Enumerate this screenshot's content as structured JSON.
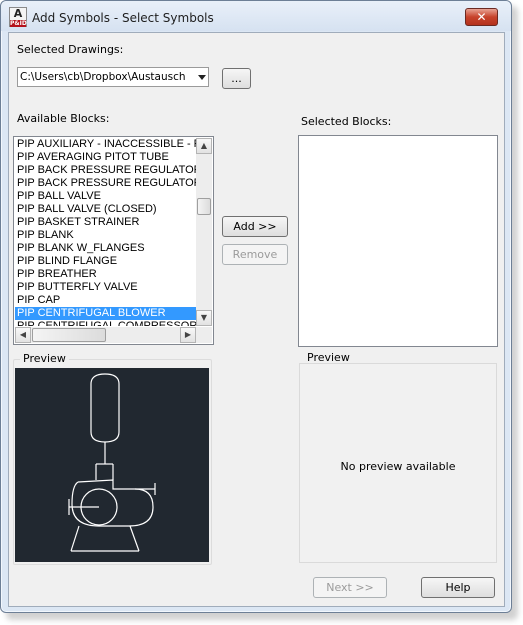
{
  "window": {
    "title": "Add Symbols - Select Symbols",
    "icon_letter": "A",
    "icon_badge": "P&ID",
    "close_glyph": "✕"
  },
  "drawings": {
    "label": "Selected Drawings:",
    "selected_value": "C:\\Users\\cb\\Dropbox\\Austausch Te",
    "browse_label": "..."
  },
  "available": {
    "label": "Available Blocks:",
    "selected_index": 13,
    "items": [
      "PIP AUXILIARY - INACCESSIBLE - P",
      "PIP AVERAGING PITOT TUBE",
      "PIP BACK PRESSURE REGULATOR",
      "PIP BACK PRESSURE REGULATOR",
      "PIP BALL VALVE",
      "PIP BALL VALVE (CLOSED)",
      "PIP BASKET STRAINER",
      "PIP BLANK",
      "PIP BLANK W_FLANGES",
      "PIP BLIND FLANGE",
      "PIP BREATHER",
      "PIP BUTTERFLY VALVE",
      "PIP CAP",
      "PIP CENTRIFUGAL BLOWER",
      "PIP CENTRIFUGAL COMPRESSOR"
    ]
  },
  "selected_blocks": {
    "label": "Selected Blocks:"
  },
  "actions": {
    "add_label": "Add >>",
    "remove_label": "Remove"
  },
  "preview_left": {
    "title": "Preview"
  },
  "preview_right": {
    "title": "Preview",
    "empty_text": "No preview available"
  },
  "footer": {
    "next_label": "Next >>",
    "help_label": "Help"
  },
  "colors": {
    "selection": "#3399ff",
    "preview_background": "#212830",
    "preview_stroke": "#ffffff",
    "close_button": "#c7432c"
  }
}
